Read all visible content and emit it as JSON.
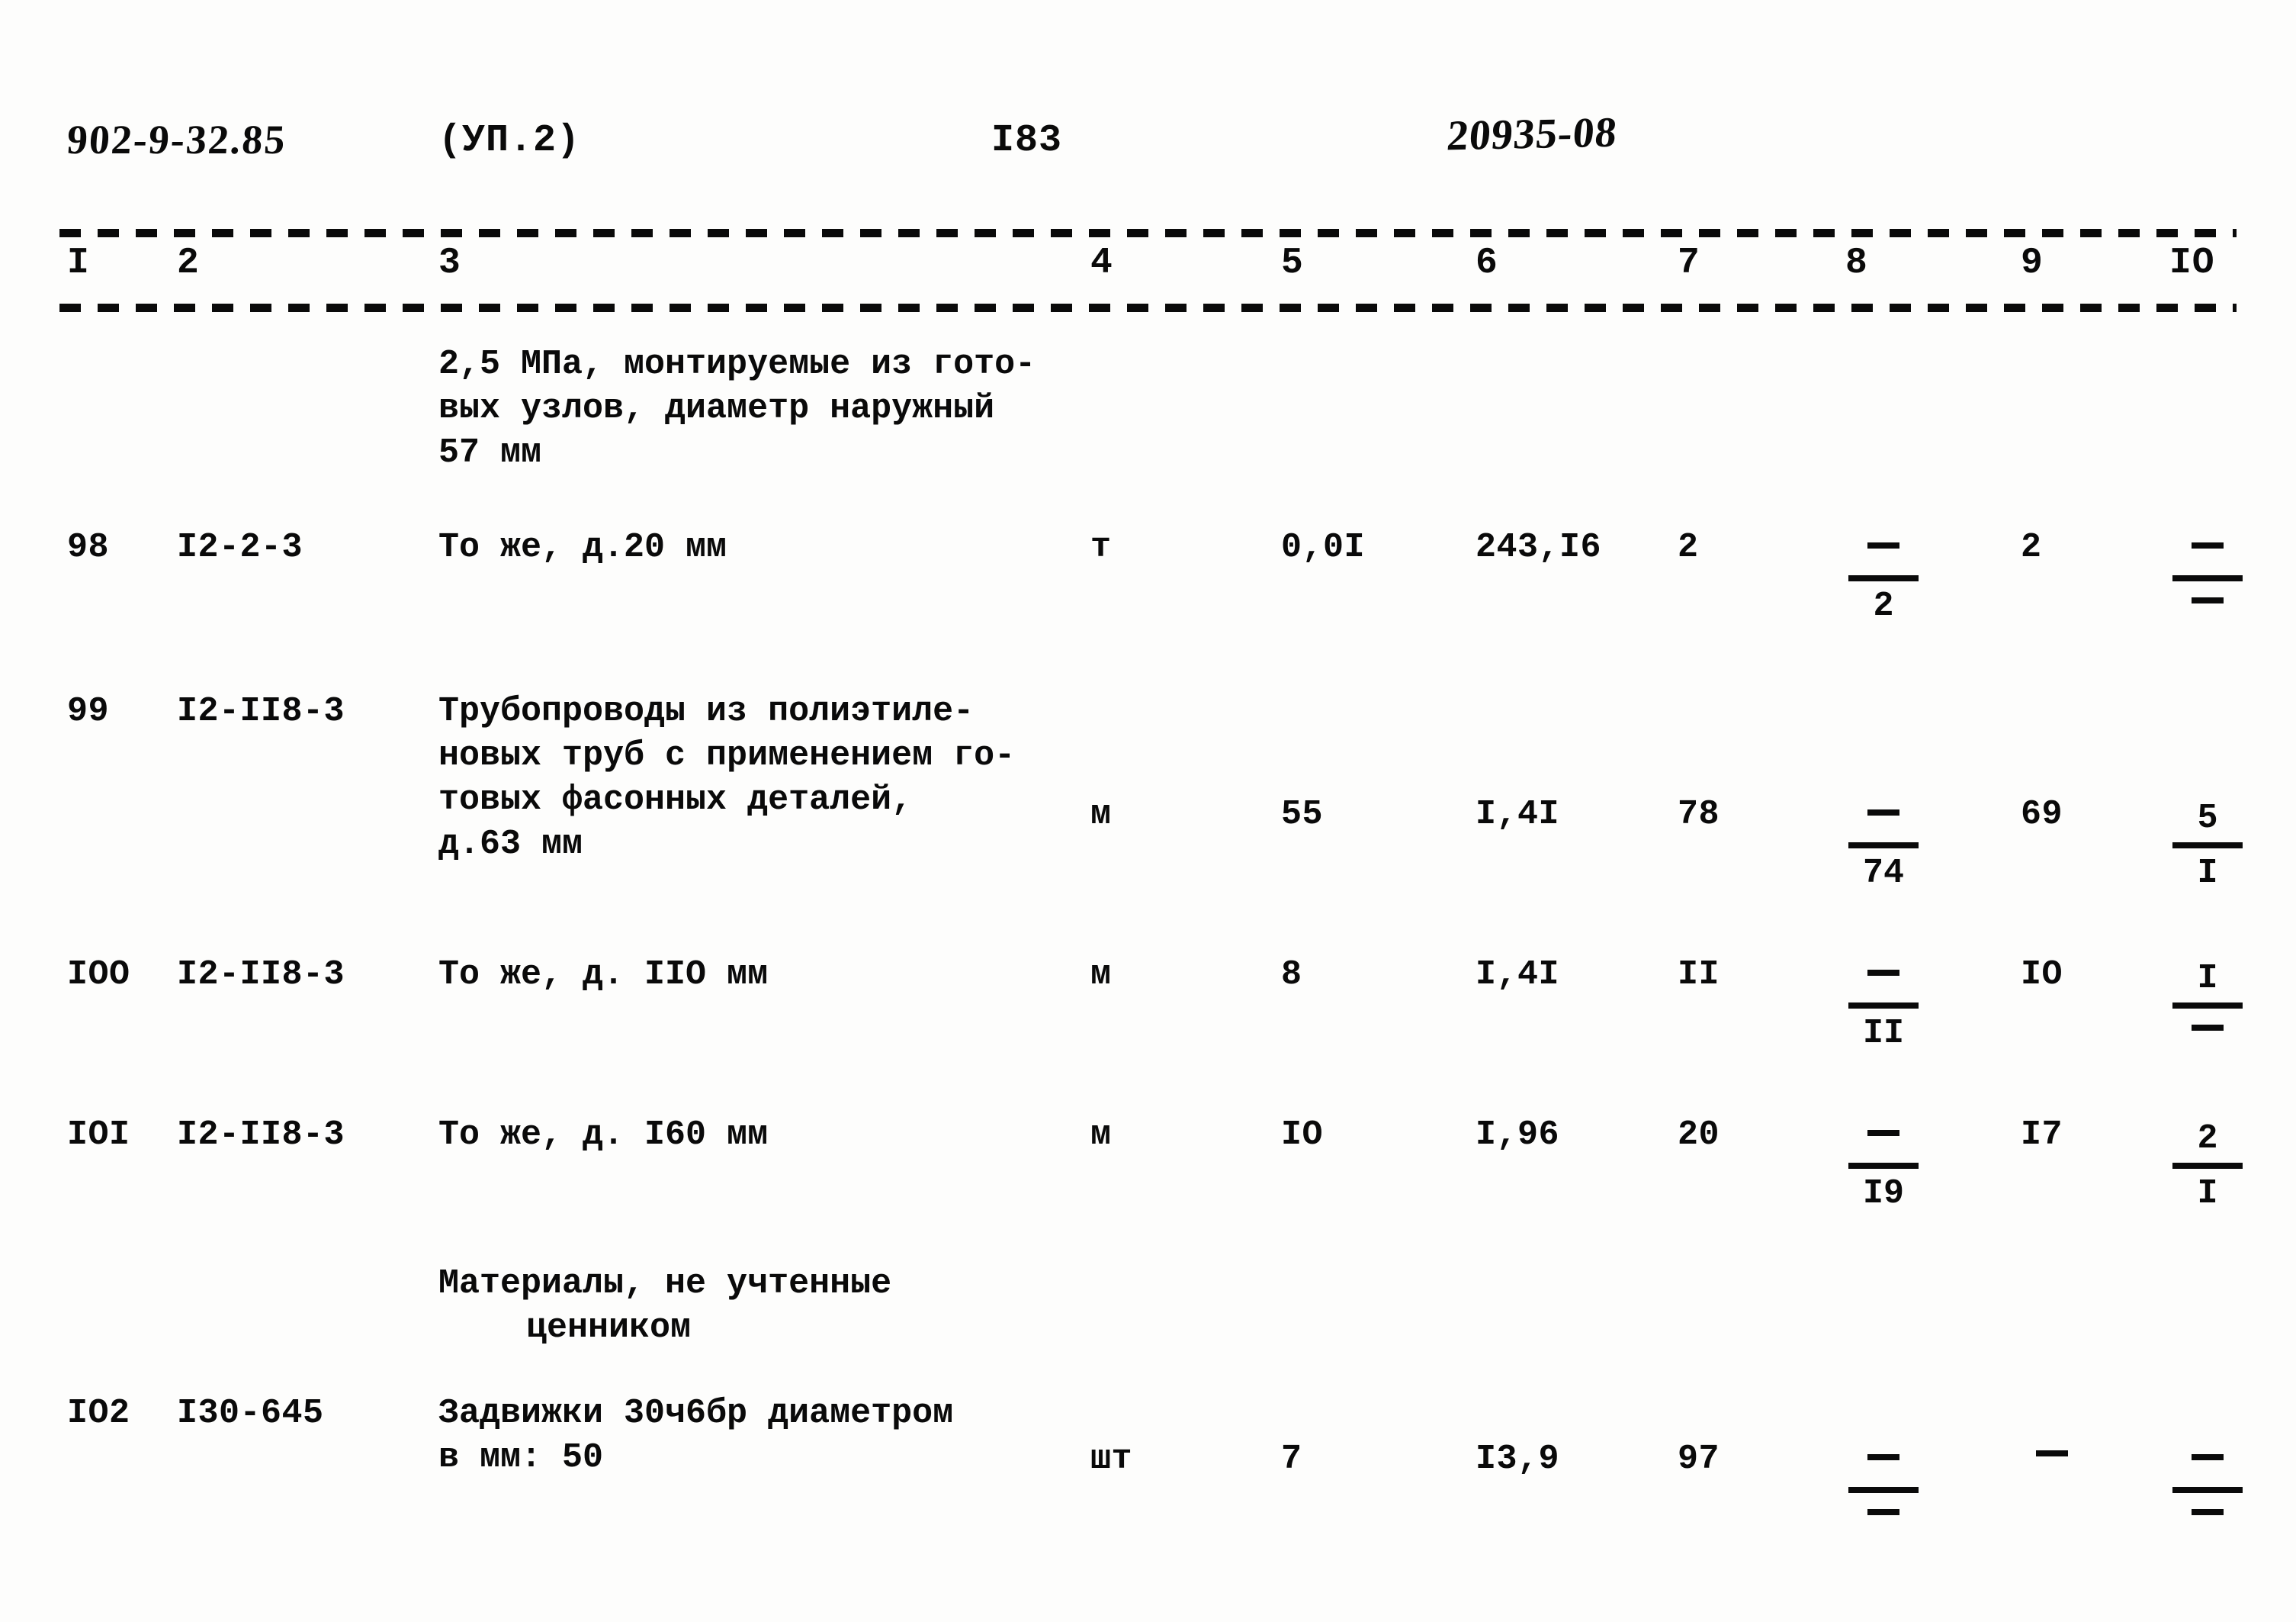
{
  "header": {
    "doc_code": "902-9-32.85",
    "doc_part": "(УП.2)",
    "page_number": "I83",
    "stamp_number": "20935-08"
  },
  "column_numbers": [
    "I",
    "2",
    "3",
    "4",
    "5",
    "6",
    "7",
    "8",
    "9",
    "IO"
  ],
  "intro_block": {
    "line1": "2,5 МПа, монтируемые из гото-",
    "line2": "вых узлов, диаметр наружный",
    "line3": "57 мм"
  },
  "section_heading": {
    "line1": "Материалы, не учтенные",
    "line2": "ценником"
  },
  "rows": [
    {
      "num": "98",
      "code": "I2-2-3",
      "desc": [
        "То же, д.20 мм"
      ],
      "unit": "т",
      "col5": "0,0I",
      "col6": "243,I6",
      "col7": "2",
      "col8_num": "—",
      "col8_den": "2",
      "col9": "2",
      "col10_num": "—",
      "col10_den": "—"
    },
    {
      "num": "99",
      "code": "I2-II8-3",
      "desc": [
        "Трубопроводы из полиэтиле-",
        "новых труб с применением го-",
        "товых фасонных деталей,",
        "д.63 мм"
      ],
      "unit": "м",
      "col5": "55",
      "col6": "I,4I",
      "col7": "78",
      "col8_num": "—",
      "col8_den": "74",
      "col9": "69",
      "col10_num": "5",
      "col10_den": "I"
    },
    {
      "num": "IOO",
      "code": "I2-II8-3",
      "desc": [
        "То же, д. IIO мм"
      ],
      "unit": "м",
      "col5": "8",
      "col6": "I,4I",
      "col7": "II",
      "col8_num": "—",
      "col8_den": "II",
      "col9": "IO",
      "col10_num": "I",
      "col10_den": "—"
    },
    {
      "num": "IOI",
      "code": "I2-II8-3",
      "desc": [
        "То же, д. I60 мм"
      ],
      "unit": "м",
      "col5": "IO",
      "col6": "I,96",
      "col7": "20",
      "col8_num": "—",
      "col8_den": "I9",
      "col9": "I7",
      "col10_num": "2",
      "col10_den": "I"
    },
    {
      "num": "IO2",
      "code": "I30-645",
      "desc": [
        "Задвижки 30ч6бр диаметром",
        "в мм: 50"
      ],
      "unit": "шт",
      "col5": "7",
      "col6": "I3,9",
      "col7": "97",
      "col8_num": "—",
      "col8_den": "—",
      "col9": "—",
      "col10_num": "—",
      "col10_den": "—"
    }
  ]
}
